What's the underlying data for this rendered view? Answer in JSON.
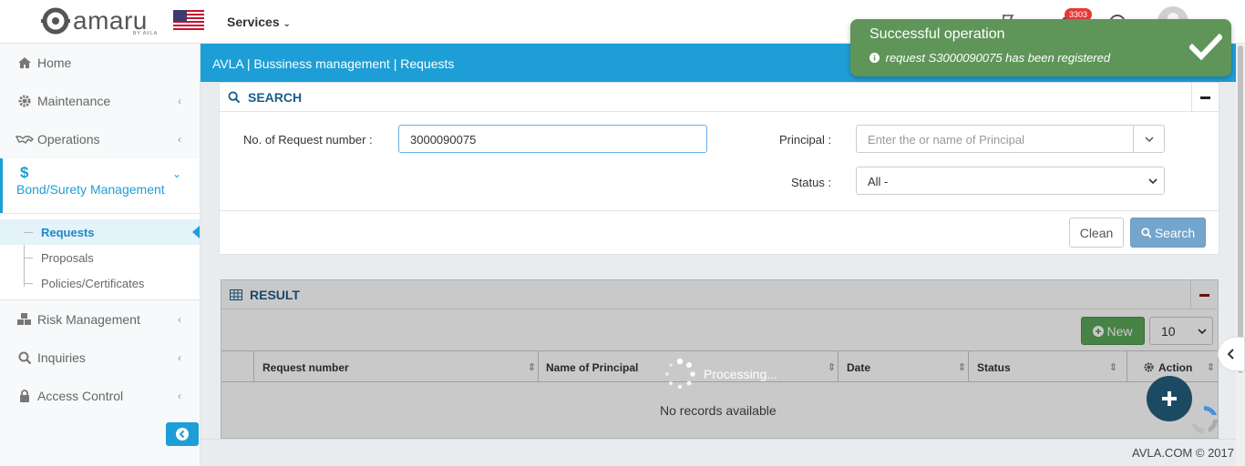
{
  "header": {
    "logo_text": "amaru",
    "logo_sub": "BY AVLA",
    "services_label": "Services",
    "notification_count": "3303"
  },
  "sidebar": {
    "items": [
      {
        "label": "Home",
        "icon": "home-icon"
      },
      {
        "label": "Maintenance",
        "icon": "gear-icon"
      },
      {
        "label": "Operations",
        "icon": "handshake-icon"
      },
      {
        "label": "Bond/Surety Management",
        "icon": "dollar-icon"
      },
      {
        "label": "Risk Management",
        "icon": "cubes-icon"
      },
      {
        "label": "Inquiries",
        "icon": "search-icon"
      },
      {
        "label": "Access Control",
        "icon": "lock-icon"
      }
    ],
    "subitems": [
      {
        "label": "Requests"
      },
      {
        "label": "Proposals"
      },
      {
        "label": "Policies/Certificates"
      }
    ]
  },
  "breadcrumb": "AVLA | Bussiness management | Requests",
  "search": {
    "title": "SEARCH",
    "request_label": "No. of Request number :",
    "request_value": "3000090075",
    "principal_label": "Principal :",
    "principal_placeholder": "Enter the or name of Principal",
    "status_label": "Status :",
    "status_value": "All -",
    "clean_label": "Clean",
    "search_label": "Search"
  },
  "result": {
    "title": "RESULT",
    "new_label": "New",
    "page_size": "10",
    "columns": [
      "Request number",
      "Name of Principal",
      "Date",
      "Status",
      "Action"
    ],
    "processing": "Processing...",
    "empty": "No records available"
  },
  "toast": {
    "title": "Successful operation",
    "message": "request S3000090075 has been registered"
  },
  "footer": "AVLA.COM © 2017",
  "colors": {
    "primary": "#1e9ed6",
    "success": "#5f9559",
    "badge": "#e53935"
  }
}
